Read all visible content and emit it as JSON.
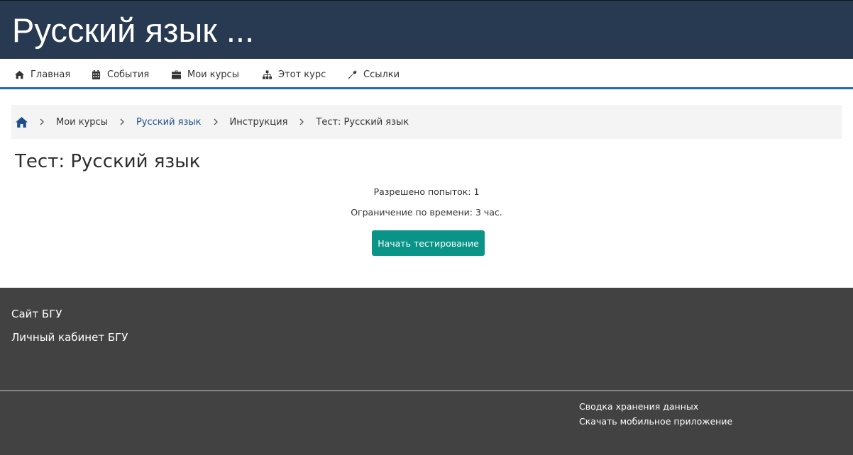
{
  "header": {
    "site_title": "Русский язык ..."
  },
  "nav": {
    "items": [
      {
        "label": "Главная",
        "icon": "home-icon"
      },
      {
        "label": "События",
        "icon": "calendar-icon"
      },
      {
        "label": "Мои курсы",
        "icon": "briefcase-icon"
      },
      {
        "label": "Этот курс",
        "icon": "sitemap-icon"
      },
      {
        "label": "Ссылки",
        "icon": "wrench-icon"
      }
    ]
  },
  "breadcrumb": {
    "items": [
      {
        "label": "Мои курсы",
        "link": false
      },
      {
        "label": "Русский язык",
        "link": true
      },
      {
        "label": "Инструкция",
        "link": false
      },
      {
        "label": "Тест: Русский язык",
        "link": false
      }
    ]
  },
  "main": {
    "title": "Тест: Русский язык",
    "attempts": "Разрешено попыток: 1",
    "time_limit": "Ограничение по времени: 3 час.",
    "start_button": "Начать тестирование"
  },
  "footer": {
    "links": [
      "Сайт БГУ",
      "Личный кабинет БГУ"
    ],
    "data_retention": "Сводка хранения данных",
    "mobile_app": "Скачать мобильное приложение"
  },
  "colors": {
    "header_bg": "#283a51",
    "nav_underline": "#1f6fb4",
    "link": "#1d4e89",
    "button": "#0a9488",
    "footer_bg": "#424242"
  }
}
